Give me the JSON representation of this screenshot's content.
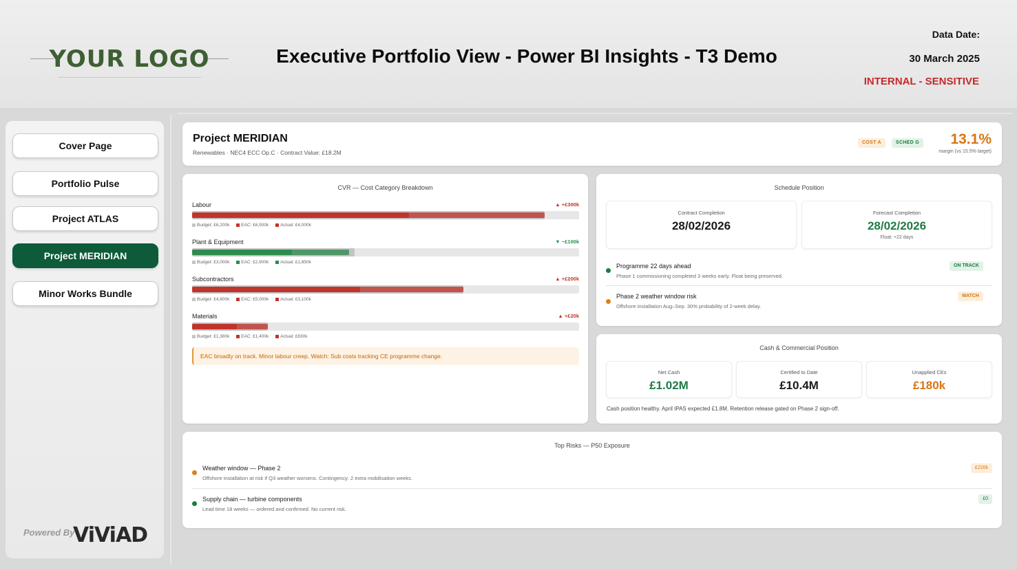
{
  "header": {
    "logo_text": "YOUR LOGO",
    "title": "Executive Portfolio View - Power BI Insights - T3 Demo",
    "data_date_label": "Data Date:",
    "data_date_value": "30 March 2025",
    "sensitivity": "INTERNAL - SENSITIVE"
  },
  "sidebar": {
    "items": [
      {
        "label": "Cover Page",
        "active": false
      },
      {
        "label": "Portfolio Pulse",
        "active": false
      },
      {
        "label": "Project ATLAS",
        "active": false
      },
      {
        "label": "Project MERIDIAN",
        "active": true
      },
      {
        "label": "Minor Works Bundle",
        "active": false
      }
    ],
    "powered_by": "Powered By",
    "brand": "ViViAD"
  },
  "project": {
    "name": "Project MERIDIAN",
    "subtitle": "Renewables · NEC4 ECC Op.C · Contract Value: £18.2M",
    "badges": [
      {
        "label": "COST A",
        "tone": "amber"
      },
      {
        "label": "SCHED G",
        "tone": "green"
      }
    ],
    "margin": "13.1%",
    "margin_note": "margin (vs 15.5% target)"
  },
  "cvr": {
    "title": "CVR — Cost Category Breakdown",
    "rows": [
      {
        "label": "Labour",
        "variance": "▲ +£300k",
        "direction": "up",
        "budget_text": "Budget: £6,200k",
        "eac_text": "EAC: £6,500k",
        "actual_text": "Actual: £4,000k",
        "budget_k": 6200,
        "eac_k": 6500,
        "actual_k": 4000,
        "color": "#c0352b"
      },
      {
        "label": "Plant & Equipment",
        "variance": "▼ −£100k",
        "direction": "down",
        "budget_text": "Budget: £3,000k",
        "eac_text": "EAC: £2,900k",
        "actual_text": "Actual: £1,850k",
        "budget_k": 3000,
        "eac_k": 2900,
        "actual_k": 1850,
        "color": "#2e8b4e"
      },
      {
        "label": "Subcontractors",
        "variance": "▲ +£200k",
        "direction": "up",
        "budget_text": "Budget: £4,800k",
        "eac_text": "EAC: £5,000k",
        "actual_text": "Actual: £3,100k",
        "budget_k": 4800,
        "eac_k": 5000,
        "actual_k": 3100,
        "color": "#c0352b"
      },
      {
        "label": "Materials",
        "variance": "▲ +£20k",
        "direction": "up",
        "budget_text": "Budget: £1,380k",
        "eac_text": "EAC: £1,400k",
        "actual_text": "Actual: £830k",
        "budget_k": 1380,
        "eac_k": 1400,
        "actual_k": 830,
        "color": "#c0352b"
      }
    ],
    "note": "EAC broadly on track. Minor labour creep. Watch: Sub costs tracking CE programme change."
  },
  "schedule": {
    "title": "Schedule Position",
    "contract_label": "Contract Completion",
    "contract_value": "28/02/2026",
    "forecast_label": "Forecast Completion",
    "forecast_value": "28/02/2026",
    "forecast_note": "Float: +22 days",
    "items": [
      {
        "title": "Programme 22 days ahead",
        "desc": "Phase 1 commissioning completed 3 weeks early. Float being preserved.",
        "status": "ON TRACK",
        "tone": "green"
      },
      {
        "title": "Phase 2 weather window risk",
        "desc": "Offshore installation Aug–Sep. 30% probability of 2-week delay.",
        "status": "WATCH",
        "tone": "amber"
      }
    ]
  },
  "cash": {
    "title": "Cash & Commercial Position",
    "boxes": [
      {
        "label": "Net Cash",
        "value": "£1.02M",
        "tone": "green"
      },
      {
        "label": "Certified to Date",
        "value": "£10.4M",
        "tone": "dark"
      },
      {
        "label": "Unapplied CEs",
        "value": "£180k",
        "tone": "amber"
      }
    ],
    "note": "Cash position healthy. April IPAS expected £1.8M. Retention release gated on Phase 2 sign-off."
  },
  "risks": {
    "title": "Top Risks — P50 Exposure",
    "items": [
      {
        "title": "Weather window — Phase 2",
        "desc": "Offshore installation at risk if Q3 weather worsens. Contingency: 2 extra mobilisation weeks.",
        "exposure": "£220k",
        "tone": "amber"
      },
      {
        "title": "Supply chain — turbine components",
        "desc": "Lead time 18 weeks — ordered and confirmed. No current risk.",
        "exposure": "£0",
        "tone": "green"
      }
    ]
  },
  "colors": {
    "accent_green": "#0d5b3a",
    "red": "#c0352b",
    "green": "#2e8b4e",
    "amber": "#d97512"
  }
}
